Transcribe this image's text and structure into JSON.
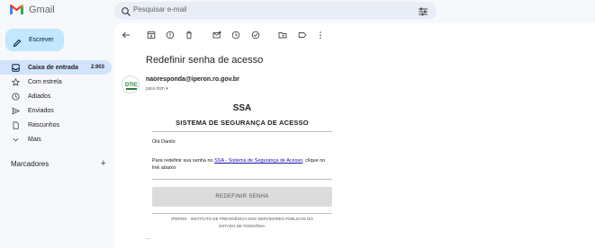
{
  "app": {
    "name": "Gmail"
  },
  "search": {
    "placeholder": "Pesquisar e-mail"
  },
  "compose": {
    "label": "Escrever"
  },
  "nav": [
    {
      "label": "Caixa de entrada",
      "count": "2.903",
      "icon": "inbox-icon",
      "active": true
    },
    {
      "label": "Com estrela",
      "count": "",
      "icon": "star-icon",
      "active": false
    },
    {
      "label": "Adiados",
      "count": "",
      "icon": "clock-icon",
      "active": false
    },
    {
      "label": "Enviados",
      "count": "",
      "icon": "send-icon",
      "active": false
    },
    {
      "label": "Rascunhos",
      "count": "",
      "icon": "draft-icon",
      "active": false
    },
    {
      "label": "Mais",
      "count": "",
      "icon": "chevron-down-icon",
      "active": false
    }
  ],
  "labels": {
    "title": "Marcadores",
    "add": "+"
  },
  "email": {
    "subject": "Redefinir senha de acesso",
    "sender": "naoresponda@iperon.ro.gov.br",
    "to": "para mim ▾",
    "avatar_text": "DTIC",
    "body": {
      "title": "SSA",
      "subtitle": "SISTEMA DE SEGURANÇA DE ACESSO",
      "greeting": "Olá Danilo",
      "instr_before": "Para redefinir sua senha no ",
      "instr_link": "SSA - Sistema de Segurança de Acesso",
      "instr_after": ", clique no link abaixo:",
      "button": "REDEFINIR SENHA",
      "footer_line1": "IPERON - INSTITUTO DE PREVIDÊNCIA DOS SERVIDORES PÚBLICOS DO",
      "footer_line2": "ESTADO DE RONDÔNIA"
    },
    "ellipsis": "..."
  },
  "colors": {
    "background": "#f6f8fc",
    "compose": "#c2e7ff",
    "nav_active": "#d3e3fd",
    "search": "#e9eef6",
    "link": "#1a0dab",
    "button": "#dcdcdc"
  }
}
